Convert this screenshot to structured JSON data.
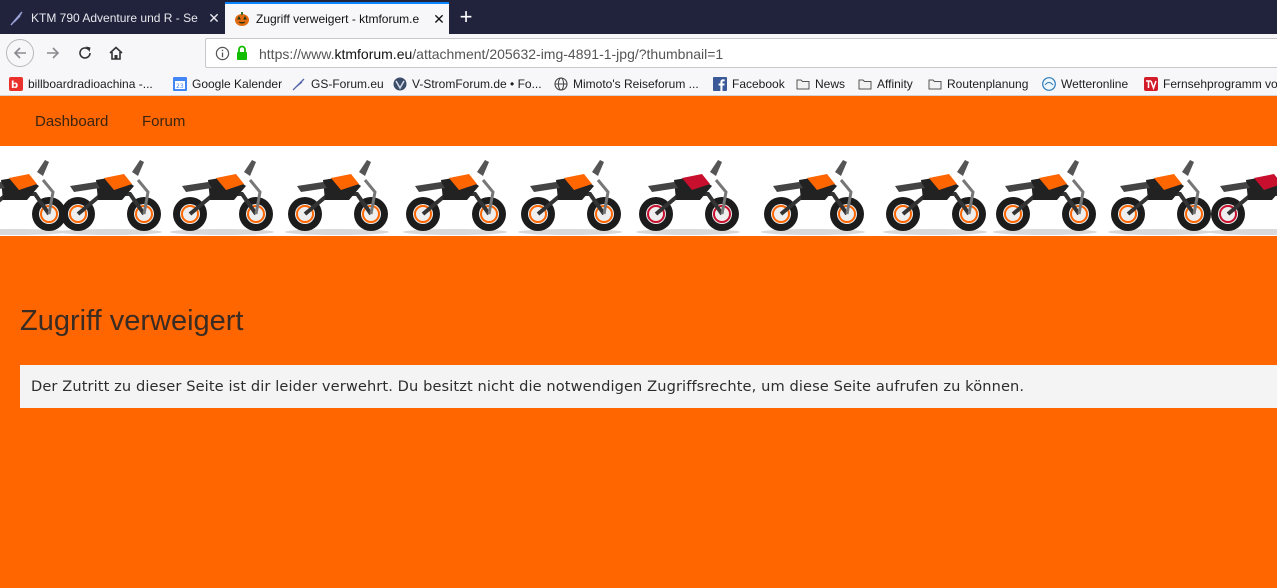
{
  "browser": {
    "tabs": [
      {
        "title": "KTM 790 Adventure und R - Se",
        "icon": "feather-icon",
        "active": false
      },
      {
        "title": "Zugriff verweigert - ktmforum.e",
        "icon": "pumpkin-icon",
        "active": true
      }
    ],
    "new_tab_label": "+",
    "url": {
      "prefix": "https://www.",
      "host": "ktmforum.eu",
      "path": "/attachment/205632-img-4891-1-jpg/?thumbnail=1"
    },
    "bookmarks": [
      {
        "label": "billboardradioachina -...",
        "icon": "billboard-icon"
      },
      {
        "label": "Google Kalender",
        "icon": "calendar-icon"
      },
      {
        "label": "GS-Forum.eu",
        "icon": "feather-icon"
      },
      {
        "label": "V-StromForum.de • Fo...",
        "icon": "vstrom-icon"
      },
      {
        "label": "Mimoto's Reiseforum ...",
        "icon": "globe-icon"
      },
      {
        "label": "Facebook",
        "icon": "facebook-icon"
      },
      {
        "label": "News",
        "icon": "folder-icon"
      },
      {
        "label": "Affinity",
        "icon": "folder-icon"
      },
      {
        "label": "Routenplanung",
        "icon": "folder-icon"
      },
      {
        "label": "Wetteronline",
        "icon": "weather-icon"
      },
      {
        "label": "Fernsehprogramm vo",
        "icon": "tv-icon"
      }
    ]
  },
  "site": {
    "nav": [
      "Dashboard",
      "Forum"
    ],
    "heading": "Zugriff verweigert",
    "notice": "Der Zutritt zu dieser Seite ist dir leider verwehrt. Du besitzt nicht die notwendigen Zugriffsrechte, um diese Seite aufrufen zu können."
  },
  "colors": {
    "brand_orange": "#ff6600",
    "tabbar": "#20233b",
    "active_tab_accent": "#0a84ff"
  }
}
